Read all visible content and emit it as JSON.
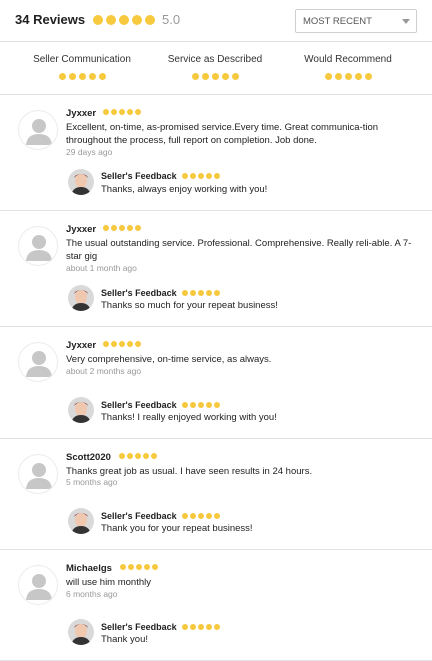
{
  "header": {
    "review_count": "34 Reviews",
    "average": "5.0",
    "sort": {
      "selected": "MOST RECENT"
    }
  },
  "breakdown": [
    {
      "label": "Seller Communication",
      "stars": 5
    },
    {
      "label": "Service as Described",
      "stars": 5
    },
    {
      "label": "Would Recommend",
      "stars": 5
    }
  ],
  "colors": {
    "star": "#f7c93e",
    "divider": "#e3e3e3",
    "muted_text": "#999999"
  },
  "icons": {
    "reviewer_avatar": "person-silhouette-icon",
    "seller_avatar": "seller-photo-icon",
    "sort_caret": "chevron-down-icon"
  },
  "seller_feedback_label": "Seller's Feedback",
  "reviews": [
    {
      "user": "Jyxxer",
      "rating": 5,
      "text": "Excellent, on-time, as-promised service.Every time. Great communica-tion throughout the process, full report on completion. Job done.",
      "when": "29 days ago",
      "seller_reply": "Thanks, always enjoy working with you!"
    },
    {
      "user": "Jyxxer",
      "rating": 5,
      "text": "The usual outstanding service. Professional. Comprehensive. Really reli-able. A 7-star gig",
      "when": "about 1 month ago",
      "seller_reply": "Thanks so much for your repeat business!"
    },
    {
      "user": "Jyxxer",
      "rating": 5,
      "text": "Very comprehensive, on-time service, as always.",
      "when": "about 2 months ago",
      "seller_reply": "Thanks! I really enjoyed working with you!"
    },
    {
      "user": "Scott2020",
      "rating": 5,
      "text": "Thanks great job as usual. I have seen results in 24 hours.",
      "when": "5 months ago",
      "seller_reply": "Thank you for your repeat business!"
    },
    {
      "user": "Michaelgs",
      "rating": 5,
      "text": "will use him monthly",
      "when": "6 months ago",
      "seller_reply": "Thank you!"
    }
  ]
}
